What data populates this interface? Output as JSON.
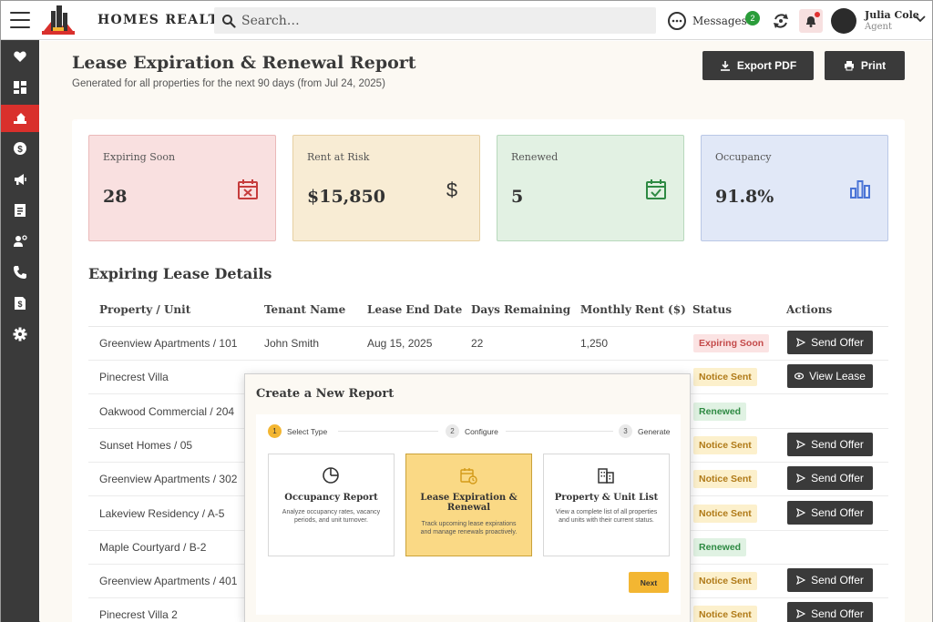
{
  "header": {
    "brand": "HOMES REALTY",
    "search_placeholder": "Search…",
    "messages_label": "Messages",
    "messages_count": "2",
    "user_name": "Julia Cole",
    "user_role": "Agent"
  },
  "page": {
    "title": "Lease Expiration & Renewal Report",
    "subtitle": "Generated for all properties for the next 90 days (from Jul 24, 2025)",
    "export_label": "Export PDF",
    "print_label": "Print"
  },
  "cards": [
    {
      "label": "Expiring Soon",
      "value": "28",
      "icon": "calendar-x-icon",
      "bg": "#f9e0e0",
      "border": "#eab9b9",
      "color": "#c63c3c"
    },
    {
      "label": "Rent at Risk",
      "value": "$15,850",
      "icon": "dollar-icon",
      "bg": "#f8ecd4",
      "border": "#e6cfa2",
      "color": "#333333"
    },
    {
      "label": "Renewed",
      "value": "5",
      "icon": "calendar-check-icon",
      "bg": "#e2f1e3",
      "border": "#b7d8bc",
      "color": "#2e8a43"
    },
    {
      "label": "Occupancy",
      "value": "91.8%",
      "icon": "bar-chart-icon",
      "bg": "#e1e8f7",
      "border": "#b9c7e6",
      "color": "#4a74d6"
    }
  ],
  "table": {
    "title": "Expiring Lease Details",
    "headers": [
      "Property / Unit",
      "Tenant Name",
      "Lease End Date",
      "Days Remaining",
      "Monthly Rent ($)",
      "Status",
      "Actions"
    ],
    "rows": [
      {
        "property": "Greenview Apartments / 101",
        "tenant": "John Smith",
        "end": "Aug 15, 2025",
        "days": "22",
        "rent": "1,250",
        "status": "Expiring Soon",
        "status_kind": "expiring",
        "action": "Send Offer",
        "action_kind": "send"
      },
      {
        "property": "Pinecrest Villa",
        "tenant": "",
        "end": "",
        "days": "",
        "rent": "",
        "status": "Notice Sent",
        "status_kind": "notice",
        "action": "View Lease",
        "action_kind": "view"
      },
      {
        "property": "Oakwood Commercial / 204",
        "tenant": "",
        "end": "",
        "days": "",
        "rent": "",
        "status": "Renewed",
        "status_kind": "renewed",
        "action": "",
        "action_kind": "none"
      },
      {
        "property": "Sunset Homes / 05",
        "tenant": "",
        "end": "",
        "days": "",
        "rent": "",
        "status": "Notice Sent",
        "status_kind": "notice",
        "action": "Send Offer",
        "action_kind": "send"
      },
      {
        "property": "Greenview Apartments / 302",
        "tenant": "",
        "end": "",
        "days": "",
        "rent": "",
        "status": "Notice Sent",
        "status_kind": "notice",
        "action": "Send Offer",
        "action_kind": "send"
      },
      {
        "property": "Lakeview Residency / A-5",
        "tenant": "",
        "end": "",
        "days": "",
        "rent": "",
        "status": "Notice Sent",
        "status_kind": "notice",
        "action": "Send Offer",
        "action_kind": "send"
      },
      {
        "property": "Maple Courtyard / B-2",
        "tenant": "",
        "end": "",
        "days": "",
        "rent": "",
        "status": "Renewed",
        "status_kind": "renewed",
        "action": "",
        "action_kind": "none"
      },
      {
        "property": "Greenview Apartments / 401",
        "tenant": "",
        "end": "",
        "days": "",
        "rent": "",
        "status": "Notice Sent",
        "status_kind": "notice",
        "action": "Send Offer",
        "action_kind": "send"
      },
      {
        "property": "Pinecrest Villa 2",
        "tenant": "",
        "end": "",
        "days": "",
        "rent": "",
        "status": "Notice Sent",
        "status_kind": "notice",
        "action": "Send Offer",
        "action_kind": "send"
      }
    ]
  },
  "modal": {
    "title": "Create a New Report",
    "steps": [
      {
        "num": "1",
        "label": "Select Type"
      },
      {
        "num": "2",
        "label": "Configure"
      },
      {
        "num": "3",
        "label": "Generate"
      }
    ],
    "types": [
      {
        "name": "Occupancy Report",
        "desc": "Analyze occupancy rates, vacancy periods, and unit turnover.",
        "icon": "pie-chart-icon"
      },
      {
        "name": "Lease Expiration & Renewal",
        "desc": "Track upcoming lease expirations and manage renewals proactively.",
        "icon": "calendar-clock-icon"
      },
      {
        "name": "Property & Unit List",
        "desc": "View a complete list of all properties and units with their current status.",
        "icon": "building-icon"
      }
    ],
    "next_label": "Next"
  },
  "sidebar": {
    "items": [
      "favorites-icon",
      "dashboard-icon",
      "properties-icon",
      "payments-icon",
      "marketing-icon",
      "documents-icon",
      "tenants-icon",
      "calls-icon",
      "invoices-icon",
      "settings-icon"
    ],
    "help": "?"
  },
  "colors": {
    "accent": "#f3b632",
    "sidebar": "#3a3a3a",
    "active": "#d9302c"
  }
}
